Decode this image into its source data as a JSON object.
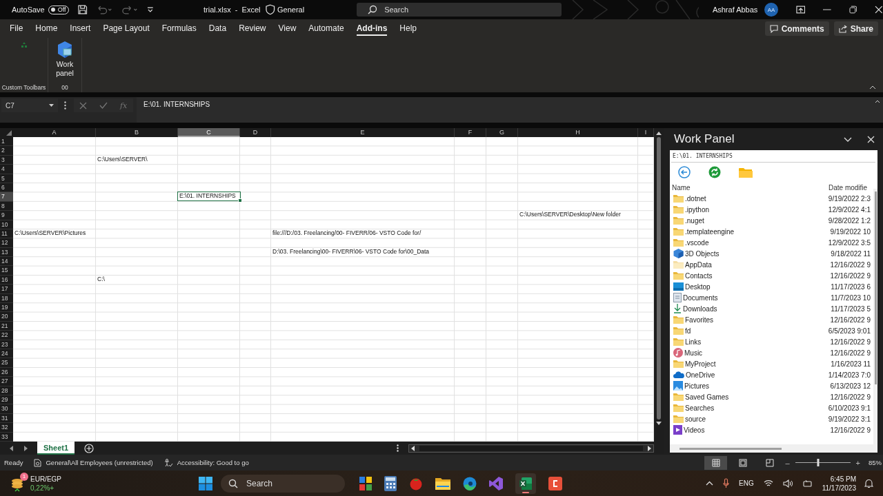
{
  "title_bar": {
    "autosave_label": "AutoSave",
    "autosave_on": false,
    "autosave_state": "Off",
    "document_title": "trial.xlsx  -  Excel",
    "sensitivity": "General",
    "search_placeholder": "Search",
    "user_name": "Ashraf Abbas",
    "user_initials": "AA"
  },
  "ribbon_tabs": [
    {
      "label": "File",
      "selected": false
    },
    {
      "label": "Home",
      "selected": false
    },
    {
      "label": "Insert",
      "selected": false
    },
    {
      "label": "Page Layout",
      "selected": false
    },
    {
      "label": "Formulas",
      "selected": false
    },
    {
      "label": "Data",
      "selected": false
    },
    {
      "label": "Review",
      "selected": false
    },
    {
      "label": "View",
      "selected": false
    },
    {
      "label": "Automate",
      "selected": false
    },
    {
      "label": "Add-ins",
      "selected": true
    },
    {
      "label": "Help",
      "selected": false
    }
  ],
  "ribbon_actions": {
    "comments": "Comments",
    "share": "Share"
  },
  "ribbon_groups": [
    {
      "label": "Custom Toolbars"
    },
    {
      "label": "00",
      "button": "Work panel"
    }
  ],
  "formula_bar": {
    "name_box": "C7",
    "fx_label": "fx",
    "formula": "E:\\01. INTERNSHIPS"
  },
  "sheet": {
    "columns": [
      {
        "label": "A",
        "selected": false
      },
      {
        "label": "B",
        "selected": false
      },
      {
        "label": "C",
        "selected": true
      },
      {
        "label": "D",
        "selected": false
      },
      {
        "label": "E",
        "selected": false
      },
      {
        "label": "F",
        "selected": false
      },
      {
        "label": "G",
        "selected": false
      },
      {
        "label": "H",
        "selected": false
      },
      {
        "label": "I",
        "selected": false
      }
    ],
    "rows": [
      {
        "label": "1",
        "selected": false
      },
      {
        "label": "2",
        "selected": false
      },
      {
        "label": "3",
        "selected": false,
        "cells": {
          "B": {
            "value": "C:\\Users\\SERVER\\",
            "selected": false
          }
        }
      },
      {
        "label": "4",
        "selected": false
      },
      {
        "label": "5",
        "selected": false
      },
      {
        "label": "6",
        "selected": false
      },
      {
        "label": "7",
        "selected": true,
        "cells": {
          "C": {
            "value": "E:\\01. INTERNSHIPS",
            "selected": true
          }
        }
      },
      {
        "label": "8",
        "selected": false
      },
      {
        "label": "9",
        "selected": false,
        "cells": {
          "H": {
            "value": "C:\\Users\\SERVER\\Desktop\\New folder",
            "selected": false
          }
        }
      },
      {
        "label": "10",
        "selected": false
      },
      {
        "label": "11",
        "selected": false,
        "cells": {
          "A": {
            "value": "C:\\Users\\SERVER\\Pictures",
            "selected": false
          },
          "E": {
            "value": "file:///D:/03. Freelancing/00- FIVERR/06- VSTO Code for/",
            "selected": false
          }
        }
      },
      {
        "label": "12",
        "selected": false
      },
      {
        "label": "13",
        "selected": false,
        "cells": {
          "E": {
            "value": "D:\\03. Freelancing\\00- FIVERR\\06- VSTO Code for\\00_Data",
            "selected": false
          }
        }
      },
      {
        "label": "14",
        "selected": false
      },
      {
        "label": "15",
        "selected": false
      },
      {
        "label": "16",
        "selected": false,
        "cells": {
          "B": {
            "value": "C:\\",
            "selected": false
          }
        }
      },
      {
        "label": "17",
        "selected": false
      },
      {
        "label": "18",
        "selected": false
      },
      {
        "label": "19",
        "selected": false
      },
      {
        "label": "20",
        "selected": false
      },
      {
        "label": "21",
        "selected": false
      },
      {
        "label": "22",
        "selected": false
      },
      {
        "label": "23",
        "selected": false
      },
      {
        "label": "24",
        "selected": false
      },
      {
        "label": "25",
        "selected": false
      },
      {
        "label": "26",
        "selected": false
      },
      {
        "label": "27",
        "selected": false
      },
      {
        "label": "28",
        "selected": false
      },
      {
        "label": "29",
        "selected": false
      },
      {
        "label": "30",
        "selected": false
      },
      {
        "label": "31",
        "selected": false
      },
      {
        "label": "32",
        "selected": false
      },
      {
        "label": "33",
        "selected": false
      }
    ],
    "tabs": [
      {
        "label": "Sheet1",
        "selected": true
      }
    ]
  },
  "work_panel": {
    "title": "Work Panel",
    "path": "E:\\01. INTERNSHIPS",
    "columns": [
      "Name",
      "Date modifie"
    ],
    "items": [
      {
        "kind": "folder",
        "name": ".dotnet",
        "date": "9/19/2022 2:3"
      },
      {
        "kind": "folder",
        "name": ".ipython",
        "date": "12/9/2022 4:1"
      },
      {
        "kind": "folder",
        "name": ".nuget",
        "date": "9/28/2022 1:2"
      },
      {
        "kind": "folder",
        "name": ".templateengine",
        "date": "9/19/2022 10"
      },
      {
        "kind": "folder",
        "name": ".vscode",
        "date": "12/9/2022 3:5"
      },
      {
        "kind": "cube",
        "name": "3D Objects",
        "date": "9/18/2022 11"
      },
      {
        "kind": "hidden_folder",
        "name": "AppData",
        "date": "12/16/2022 9"
      },
      {
        "kind": "folder",
        "name": "Contacts",
        "date": "12/16/2022 9"
      },
      {
        "kind": "desktop",
        "name": "Desktop",
        "date": "11/17/2023 6"
      },
      {
        "kind": "document",
        "name": "Documents",
        "date": "11/7/2023 10"
      },
      {
        "kind": "download",
        "name": "Downloads",
        "date": "11/17/2023 5"
      },
      {
        "kind": "folder",
        "name": "Favorites",
        "date": "12/16/2022 9"
      },
      {
        "kind": "folder",
        "name": "fd",
        "date": "6/5/2023 9:01"
      },
      {
        "kind": "folder",
        "name": "Links",
        "date": "12/16/2022 9"
      },
      {
        "kind": "music",
        "name": "Music",
        "date": "12/16/2022 9"
      },
      {
        "kind": "folder",
        "name": "MyProject",
        "date": "1/16/2023 11"
      },
      {
        "kind": "cloud",
        "name": "OneDrive",
        "date": "1/14/2023 7:0"
      },
      {
        "kind": "image",
        "name": "Pictures",
        "date": "6/13/2023 12"
      },
      {
        "kind": "folder",
        "name": "Saved Games",
        "date": "12/16/2022 9"
      },
      {
        "kind": "folder",
        "name": "Searches",
        "date": "6/10/2023 9:1"
      },
      {
        "kind": "folder",
        "name": "source",
        "date": "9/19/2022 3:1"
      },
      {
        "kind": "video",
        "name": "Videos",
        "date": "12/16/2022 9"
      }
    ]
  },
  "status_bar": {
    "ready": "Ready",
    "sensitivity": "General\\All Employees (unrestricted)",
    "accessibility": "Accessibility: Good to go",
    "view_buttons": [
      {
        "kind": "normal",
        "selected": true
      },
      {
        "kind": "page_layout",
        "selected": false
      },
      {
        "kind": "page_break",
        "selected": false
      }
    ],
    "zoom": {
      "level": 0.42,
      "reading": "85%",
      "zoom_out": "–",
      "zoom_in": "+"
    }
  },
  "taskbar": {
    "widget_title": "EUR/EGP",
    "widget_change": "0,22%+",
    "widget_badge": "1",
    "search_placeholder": "Search",
    "language": "ENG",
    "time": "6:45 PM",
    "date": "11/17/2023"
  }
}
